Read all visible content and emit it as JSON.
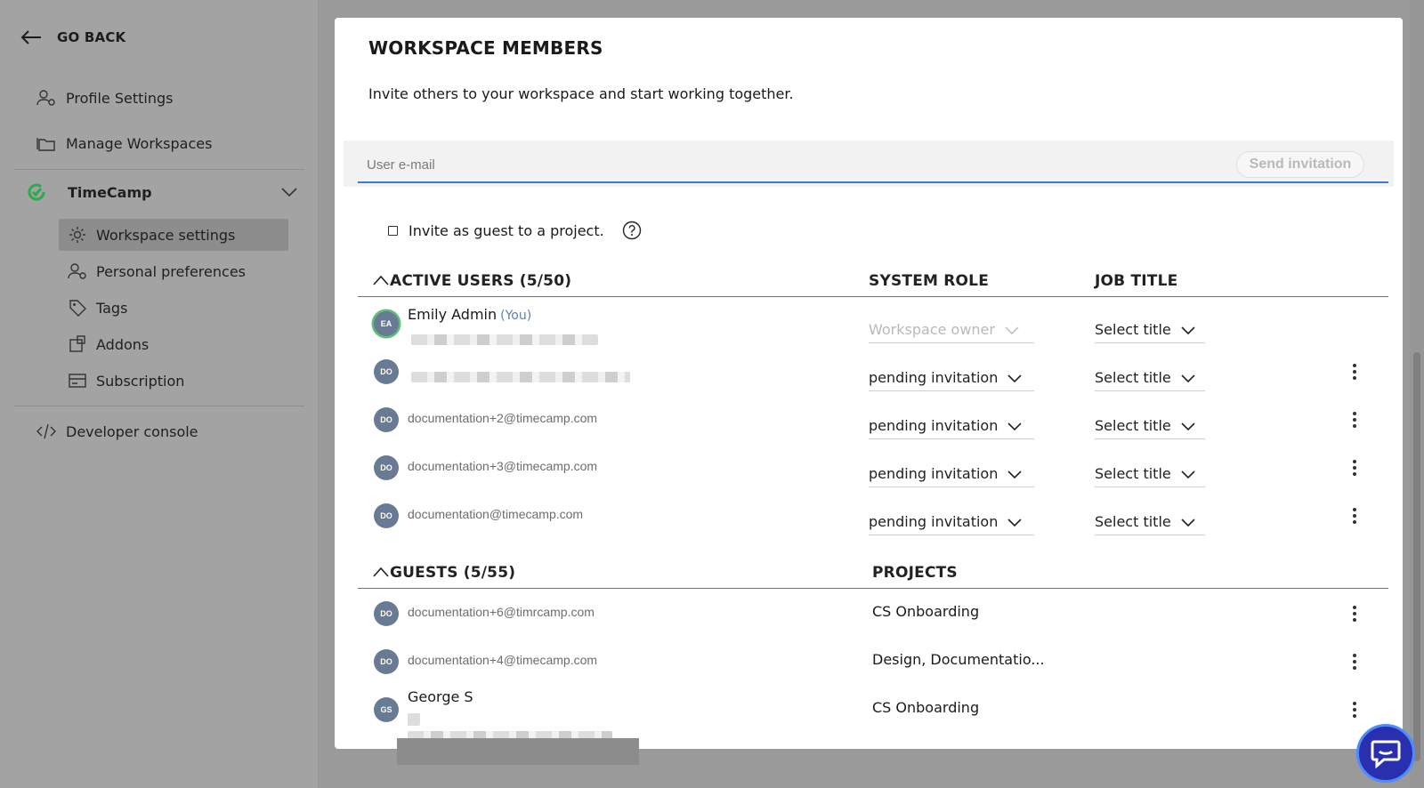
{
  "sidebar": {
    "go_back": "GO BACK",
    "items": [
      {
        "label": "Profile Settings"
      },
      {
        "label": "Manage Workspaces"
      }
    ],
    "workspace": {
      "label": "TimeCamp",
      "sub_items": [
        {
          "label": "Workspace settings",
          "active": true
        },
        {
          "label": "Personal preferences"
        },
        {
          "label": "Tags"
        },
        {
          "label": "Addons"
        },
        {
          "label": "Subscription"
        }
      ]
    },
    "developer_console": "Developer console"
  },
  "modal": {
    "title": "WORKSPACE MEMBERS",
    "subtitle": "Invite others to your workspace and start working together.",
    "email_placeholder": "User e-mail",
    "send_label": "Send invitation",
    "guest_checkbox_label": "Invite as guest to a project.",
    "active_users": {
      "heading": "ACTIVE USERS (5/50)",
      "role_header": "SYSTEM ROLE",
      "title_header": "JOB TITLE",
      "rows": [
        {
          "initials": "EA",
          "name": "Emily Admin",
          "you": "(You)",
          "role": "Workspace owner",
          "title": "Select title"
        },
        {
          "initials": "DO",
          "email": "",
          "role": "pending invitation",
          "title": "Select title"
        },
        {
          "initials": "DO",
          "email": "documentation+2@timecamp.com",
          "role": "pending invitation",
          "title": "Select title"
        },
        {
          "initials": "DO",
          "email": "documentation+3@timecamp.com",
          "role": "pending invitation",
          "title": "Select title"
        },
        {
          "initials": "DO",
          "email": "documentation@timecamp.com",
          "role": "pending invitation",
          "title": "Select title"
        }
      ]
    },
    "guests": {
      "heading": "GUESTS (5/55)",
      "projects_header": "PROJECTS",
      "rows": [
        {
          "initials": "DO",
          "email": "documentation+6@timrcamp.com",
          "projects": "CS Onboarding"
        },
        {
          "initials": "DO",
          "email": "documentation+4@timecamp.com",
          "projects": "Design, Documentatio..."
        },
        {
          "initials": "GS",
          "name": "George S",
          "projects": "CS Onboarding"
        }
      ]
    }
  },
  "colors": {
    "accent": "#3a7bd5",
    "avatar": "#697a94",
    "brand_green": "#2eaa4e",
    "chat": "#2a2fb0"
  }
}
